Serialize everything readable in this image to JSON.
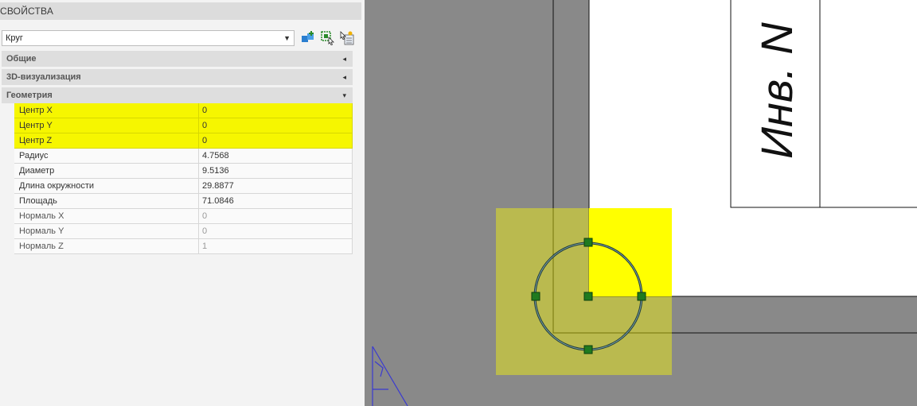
{
  "palette": {
    "title": "СВОЙСТВА",
    "object_type": "Круг",
    "sections": {
      "general": "Общие",
      "viz3d": "3D-визуализация",
      "geometry": "Геометрия"
    },
    "properties": [
      {
        "label": "Центр X",
        "value": "0"
      },
      {
        "label": "Центр Y",
        "value": "0"
      },
      {
        "label": "Центр Z",
        "value": "0"
      },
      {
        "label": "Радиус",
        "value": "4.7568"
      },
      {
        "label": "Диаметр",
        "value": "9.5136"
      },
      {
        "label": "Длина окружности",
        "value": "29.8877"
      },
      {
        "label": "Площадь",
        "value": "71.0846"
      },
      {
        "label": "Нормаль X",
        "value": "0"
      },
      {
        "label": "Нормаль Y",
        "value": "0"
      },
      {
        "label": "Нормаль Z",
        "value": "1"
      }
    ]
  },
  "drawing": {
    "stamp_text": "Инв. N",
    "colors": {
      "background": "#898989",
      "sheet": "#ffffff",
      "selection": "#ffff00",
      "grip": "#1f7a1f",
      "ucs": "#3a3ad0"
    }
  }
}
